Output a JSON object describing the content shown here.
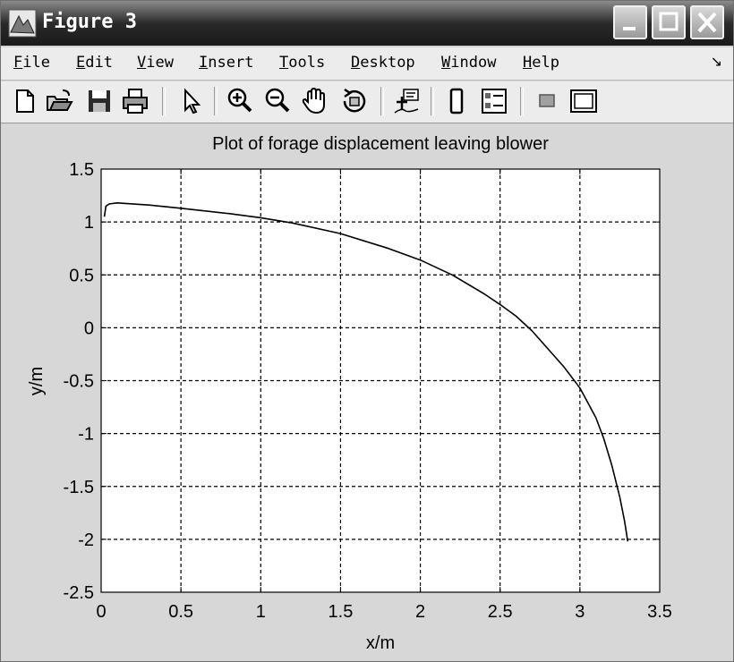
{
  "window": {
    "title": "Figure 3",
    "title_icon": "matlab-figure-icon",
    "buttons": [
      "minimize-icon",
      "maximize-icon",
      "close-icon"
    ]
  },
  "menu": {
    "items": [
      {
        "accel": "F",
        "rest": "ile"
      },
      {
        "accel": "E",
        "rest": "dit"
      },
      {
        "accel": "V",
        "rest": "iew"
      },
      {
        "accel": "I",
        "rest": "nsert"
      },
      {
        "accel": "T",
        "rest": "ools"
      },
      {
        "accel": "D",
        "rest": "esktop"
      },
      {
        "accel": "W",
        "rest": "indow"
      },
      {
        "accel": "H",
        "rest": "elp"
      }
    ],
    "dock_glyph": "↘"
  },
  "toolbar": {
    "icons": [
      "new-figure-icon",
      "open-file-icon",
      "save-icon",
      "print-icon",
      "edit-plot-arrow-icon",
      "zoom-in-icon",
      "zoom-out-icon",
      "pan-hand-icon",
      "rotate-3d-icon",
      "data-cursor-icon",
      "colorbar-icon",
      "legend-icon",
      "hide-plot-tools-icon",
      "show-plot-tools-icon"
    ]
  },
  "chart_data": {
    "type": "line",
    "title": "Plot of forage displacement leaving blower",
    "xlabel": "x/m",
    "ylabel": "y/m",
    "xlim": [
      0,
      3.5
    ],
    "ylim": [
      -2.5,
      1.5
    ],
    "xticks": [
      0,
      0.5,
      1,
      1.5,
      2,
      2.5,
      3,
      3.5
    ],
    "xtick_labels": [
      "0",
      "0.5",
      "1",
      "1.5",
      "2",
      "2.5",
      "3",
      "3.5"
    ],
    "yticks": [
      1.5,
      1,
      0.5,
      0,
      -0.5,
      -1,
      -1.5,
      -2,
      -2.5
    ],
    "ytick_labels": [
      "1.5",
      "1",
      "0.5",
      "0",
      "-0.5",
      "-1",
      "-1.5",
      "-2",
      "-2.5"
    ],
    "grid": true,
    "line_color": "#000000",
    "series": [
      {
        "x": [
          0.02,
          0.03,
          0.05,
          0.1,
          0.3,
          0.5,
          0.8,
          1.0,
          1.2,
          1.5,
          1.8,
          2.0,
          2.2,
          2.4,
          2.5,
          2.6,
          2.7,
          2.8,
          2.9,
          3.0,
          3.1,
          3.15,
          3.2,
          3.25,
          3.28,
          3.3
        ],
        "y": [
          1.05,
          1.15,
          1.17,
          1.18,
          1.16,
          1.13,
          1.08,
          1.04,
          0.99,
          0.89,
          0.75,
          0.64,
          0.5,
          0.32,
          0.22,
          0.11,
          -0.03,
          -0.2,
          -0.37,
          -0.57,
          -0.85,
          -1.05,
          -1.3,
          -1.6,
          -1.83,
          -2.02
        ]
      }
    ]
  }
}
